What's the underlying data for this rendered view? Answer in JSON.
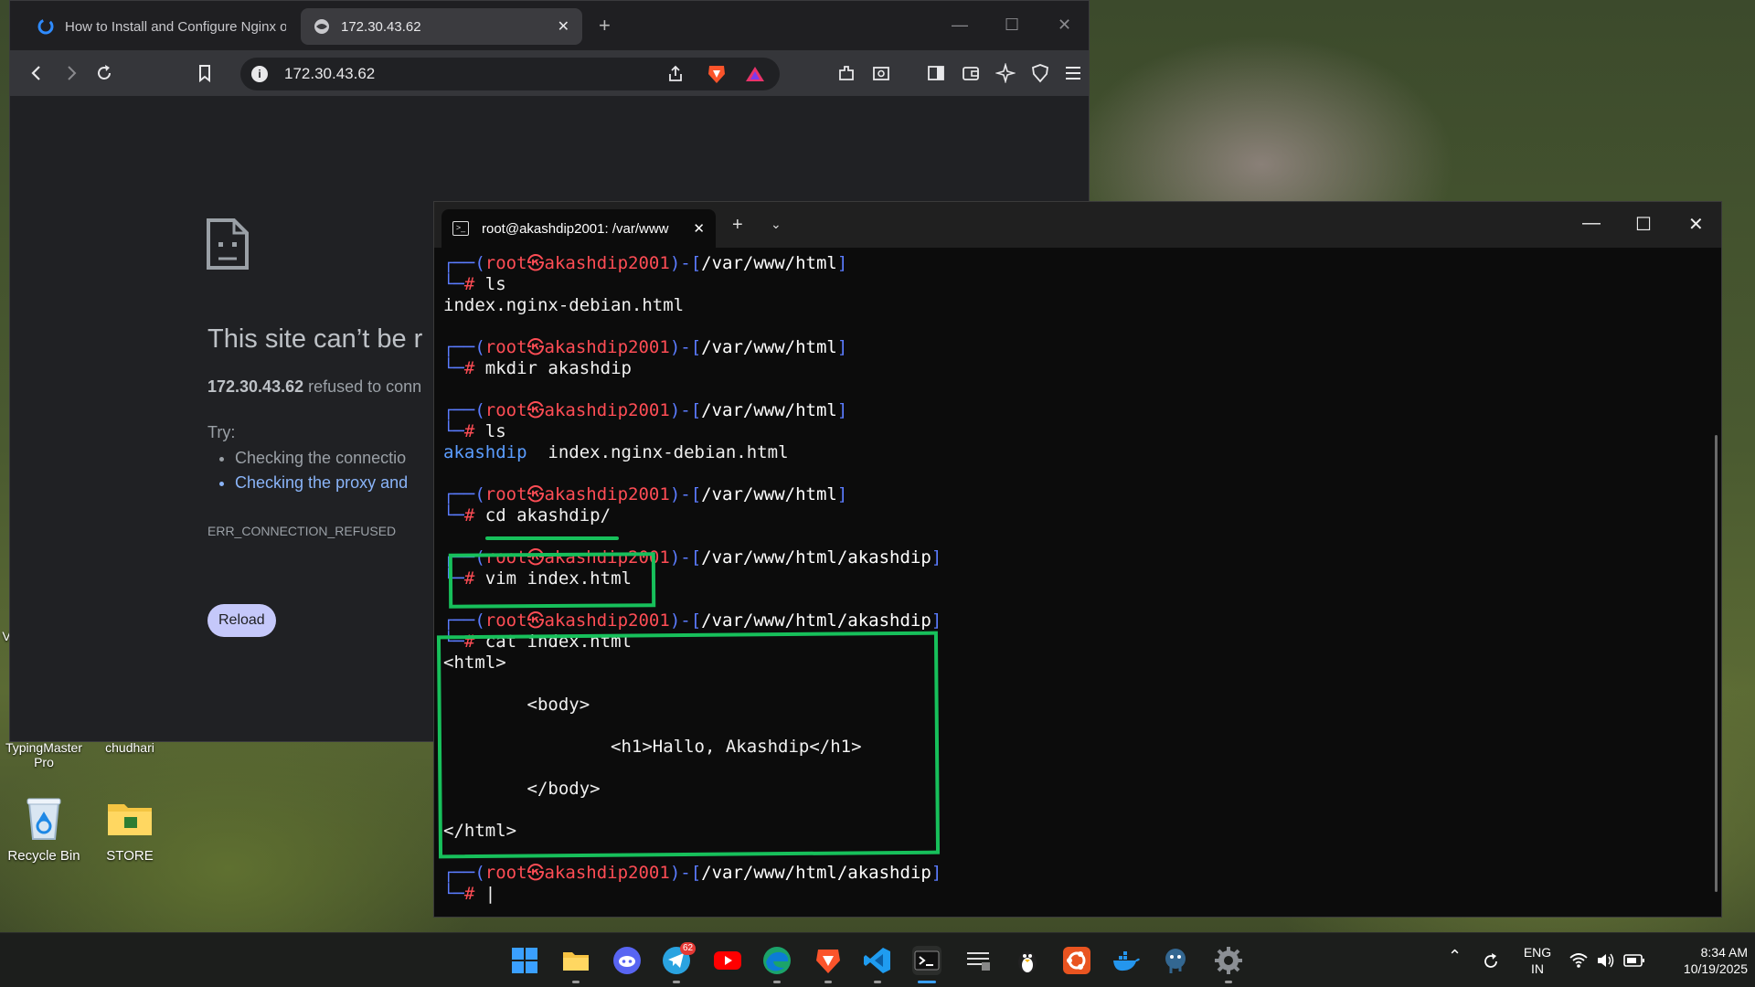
{
  "browser": {
    "tabs": [
      {
        "title": "How to Install and Configure Nginx o",
        "active": false
      },
      {
        "title": "172.30.43.62",
        "active": true
      }
    ],
    "url": "172.30.43.62",
    "error": {
      "title": "This site can’t be r",
      "host": "172.30.43.62",
      "desc_rest": " refused to conn",
      "try_label": "Try:",
      "suggestions": [
        "Checking the connectio",
        "Checking the proxy and"
      ],
      "code": "ERR_CONNECTION_REFUSED",
      "reload_label": "Reload"
    }
  },
  "terminal": {
    "tab_title": "root@akashdip2001: /var/www",
    "user": "root",
    "host": "akashdip2001",
    "prompt_symbol": "㉿",
    "blocks": [
      {
        "path": "/var/www/html",
        "cmd": "ls",
        "output": [
          "index.nginx-debian.html"
        ]
      },
      {
        "path": "/var/www/html",
        "cmd": "mkdir akashdip",
        "output": []
      },
      {
        "path": "/var/www/html",
        "cmd": "ls",
        "output_dir": "akashdip",
        "output_file": "index.nginx-debian.html"
      },
      {
        "path": "/var/www/html",
        "cmd": "cd akashdip/",
        "output": []
      },
      {
        "path": "/var/www/html/akashdip",
        "cmd": "vim index.html",
        "output": []
      },
      {
        "path": "/var/www/html/akashdip",
        "cmd": "cat index.html",
        "output": [
          "<html>",
          "",
          "        <body>",
          "",
          "                <h1>Hallo, Akashdip</h1>",
          "",
          "        </body>",
          "",
          "</html>"
        ]
      },
      {
        "path": "/var/www/html/akashdip",
        "cmd": "",
        "output": []
      }
    ]
  },
  "desktop": {
    "labels": [
      "TypingMaster Pro",
      "chudhari"
    ],
    "icons": [
      "Recycle Bin",
      "STORE"
    ],
    "edge_letter": "V"
  },
  "taskbar": {
    "apps": [
      "windows-start",
      "file-explorer",
      "discord",
      "telegram",
      "youtube",
      "edge",
      "brave",
      "vscode",
      "terminal",
      "wsl-terminal",
      "linux-penguin",
      "ubuntu",
      "docker",
      "postgresql",
      "settings"
    ],
    "telegram_badge": "62",
    "lang_top": "ENG",
    "lang_bottom": "IN",
    "time": "8:34 AM",
    "date": "10/19/2025"
  },
  "colors": {
    "prompt_frame": "#5b7cff",
    "prompt_user": "#ff4d55",
    "directory": "#5b9dff",
    "annotation": "#17c05b"
  }
}
